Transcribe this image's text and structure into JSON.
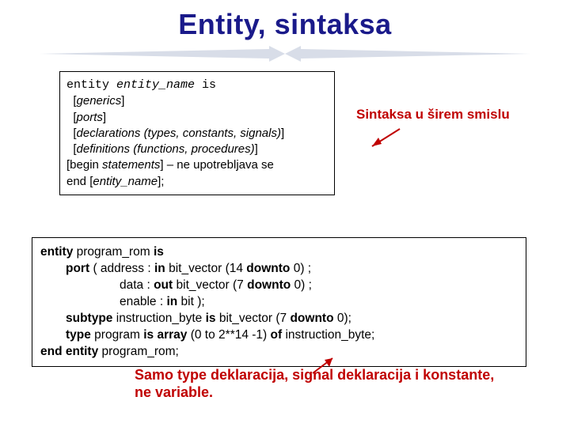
{
  "title": "Entity, sintaksa",
  "syntax": {
    "l1a": "entity ",
    "l1b": "entity_name",
    "l1c": " is",
    "l2a": "  [",
    "l2b": "generics",
    "l2c": "]",
    "l3a": "  [",
    "l3b": "ports",
    "l3c": "]",
    "l4a": "  [",
    "l4b": "declarations (types, constants, signals)",
    "l4c": "]",
    "l5a": "  [",
    "l5b": "definitions (functions, procedures)",
    "l5c": "]",
    "l6a": "[begin ",
    "l6b": "statements",
    "l6c": "] – ne upotrebljava se",
    "l7a": "end [",
    "l7b": "entity_name",
    "l7c": "];"
  },
  "annot1": "Sintaksa u širem smislu",
  "code": {
    "l1_entity": "entity",
    "l1_name": " program_rom ",
    "l1_is": "is",
    "l2_port": "port",
    "l2_rest": " ( address : ",
    "l2_in": "in",
    "l2_rest2": " bit_vector (14 ",
    "l2_downto": "downto",
    "l2_rest3": " 0) ;",
    "l3_rest": "data : ",
    "l3_out": "out",
    "l3_rest2": " bit_vector (7 ",
    "l3_downto": "downto",
    "l3_rest3": " 0) ;",
    "l4_rest": "enable : ",
    "l4_in": "in",
    "l4_rest2": " bit );",
    "l5_subtype": "subtype",
    "l5_rest": " instruction_byte ",
    "l5_is": "is",
    "l5_rest2": " bit_vector (7 ",
    "l5_downto": "downto",
    "l5_rest3": " 0);",
    "l6_type": "type",
    "l6_rest": " program ",
    "l6_is": "is",
    "l6_array": " array",
    "l6_rest2": " (0 ",
    "l6_to": "to",
    "l6_rest3": " 2**14 -1) ",
    "l6_of": "of",
    "l6_rest4": " instruction_byte;",
    "l7_end": "end entity",
    "l7_rest": " program_rom;"
  },
  "annot2": "Samo type deklaracija, signal deklaracija i konstante, ne variable."
}
